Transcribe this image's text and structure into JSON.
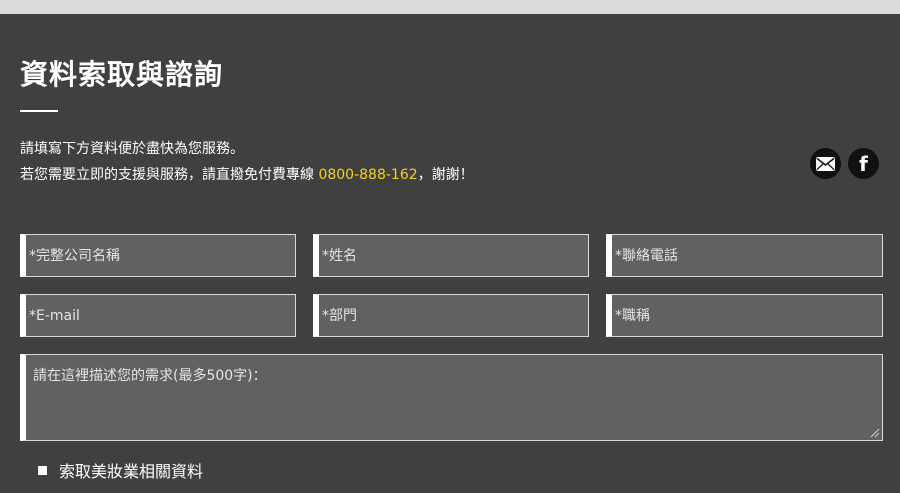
{
  "page": {
    "title": "資料索取與諮詢",
    "intro_line1": "請填寫下方資料便於盡快為您服務。",
    "intro_line2_prefix": "若您需要立即的支援與服務，請直撥免付費專線 ",
    "hotline": "0800-888-162",
    "intro_line2_suffix": "，謝謝！"
  },
  "social": {
    "mail_icon": "envelope-icon",
    "facebook_icon": "facebook-icon",
    "facebook_glyph": "f"
  },
  "form": {
    "company_placeholder": "*完整公司名稱",
    "name_placeholder": "*姓名",
    "phone_placeholder": "*聯絡電話",
    "email_placeholder": "*E-mail",
    "department_placeholder": "*部門",
    "title_placeholder": "*職稱",
    "message_placeholder": "請在這裡描述您的需求(最多500字)：",
    "checkbox_label": "索取美妝業相關資料"
  },
  "colors": {
    "background": "#404040",
    "accent": "#f2d21b",
    "field": "#616161"
  }
}
